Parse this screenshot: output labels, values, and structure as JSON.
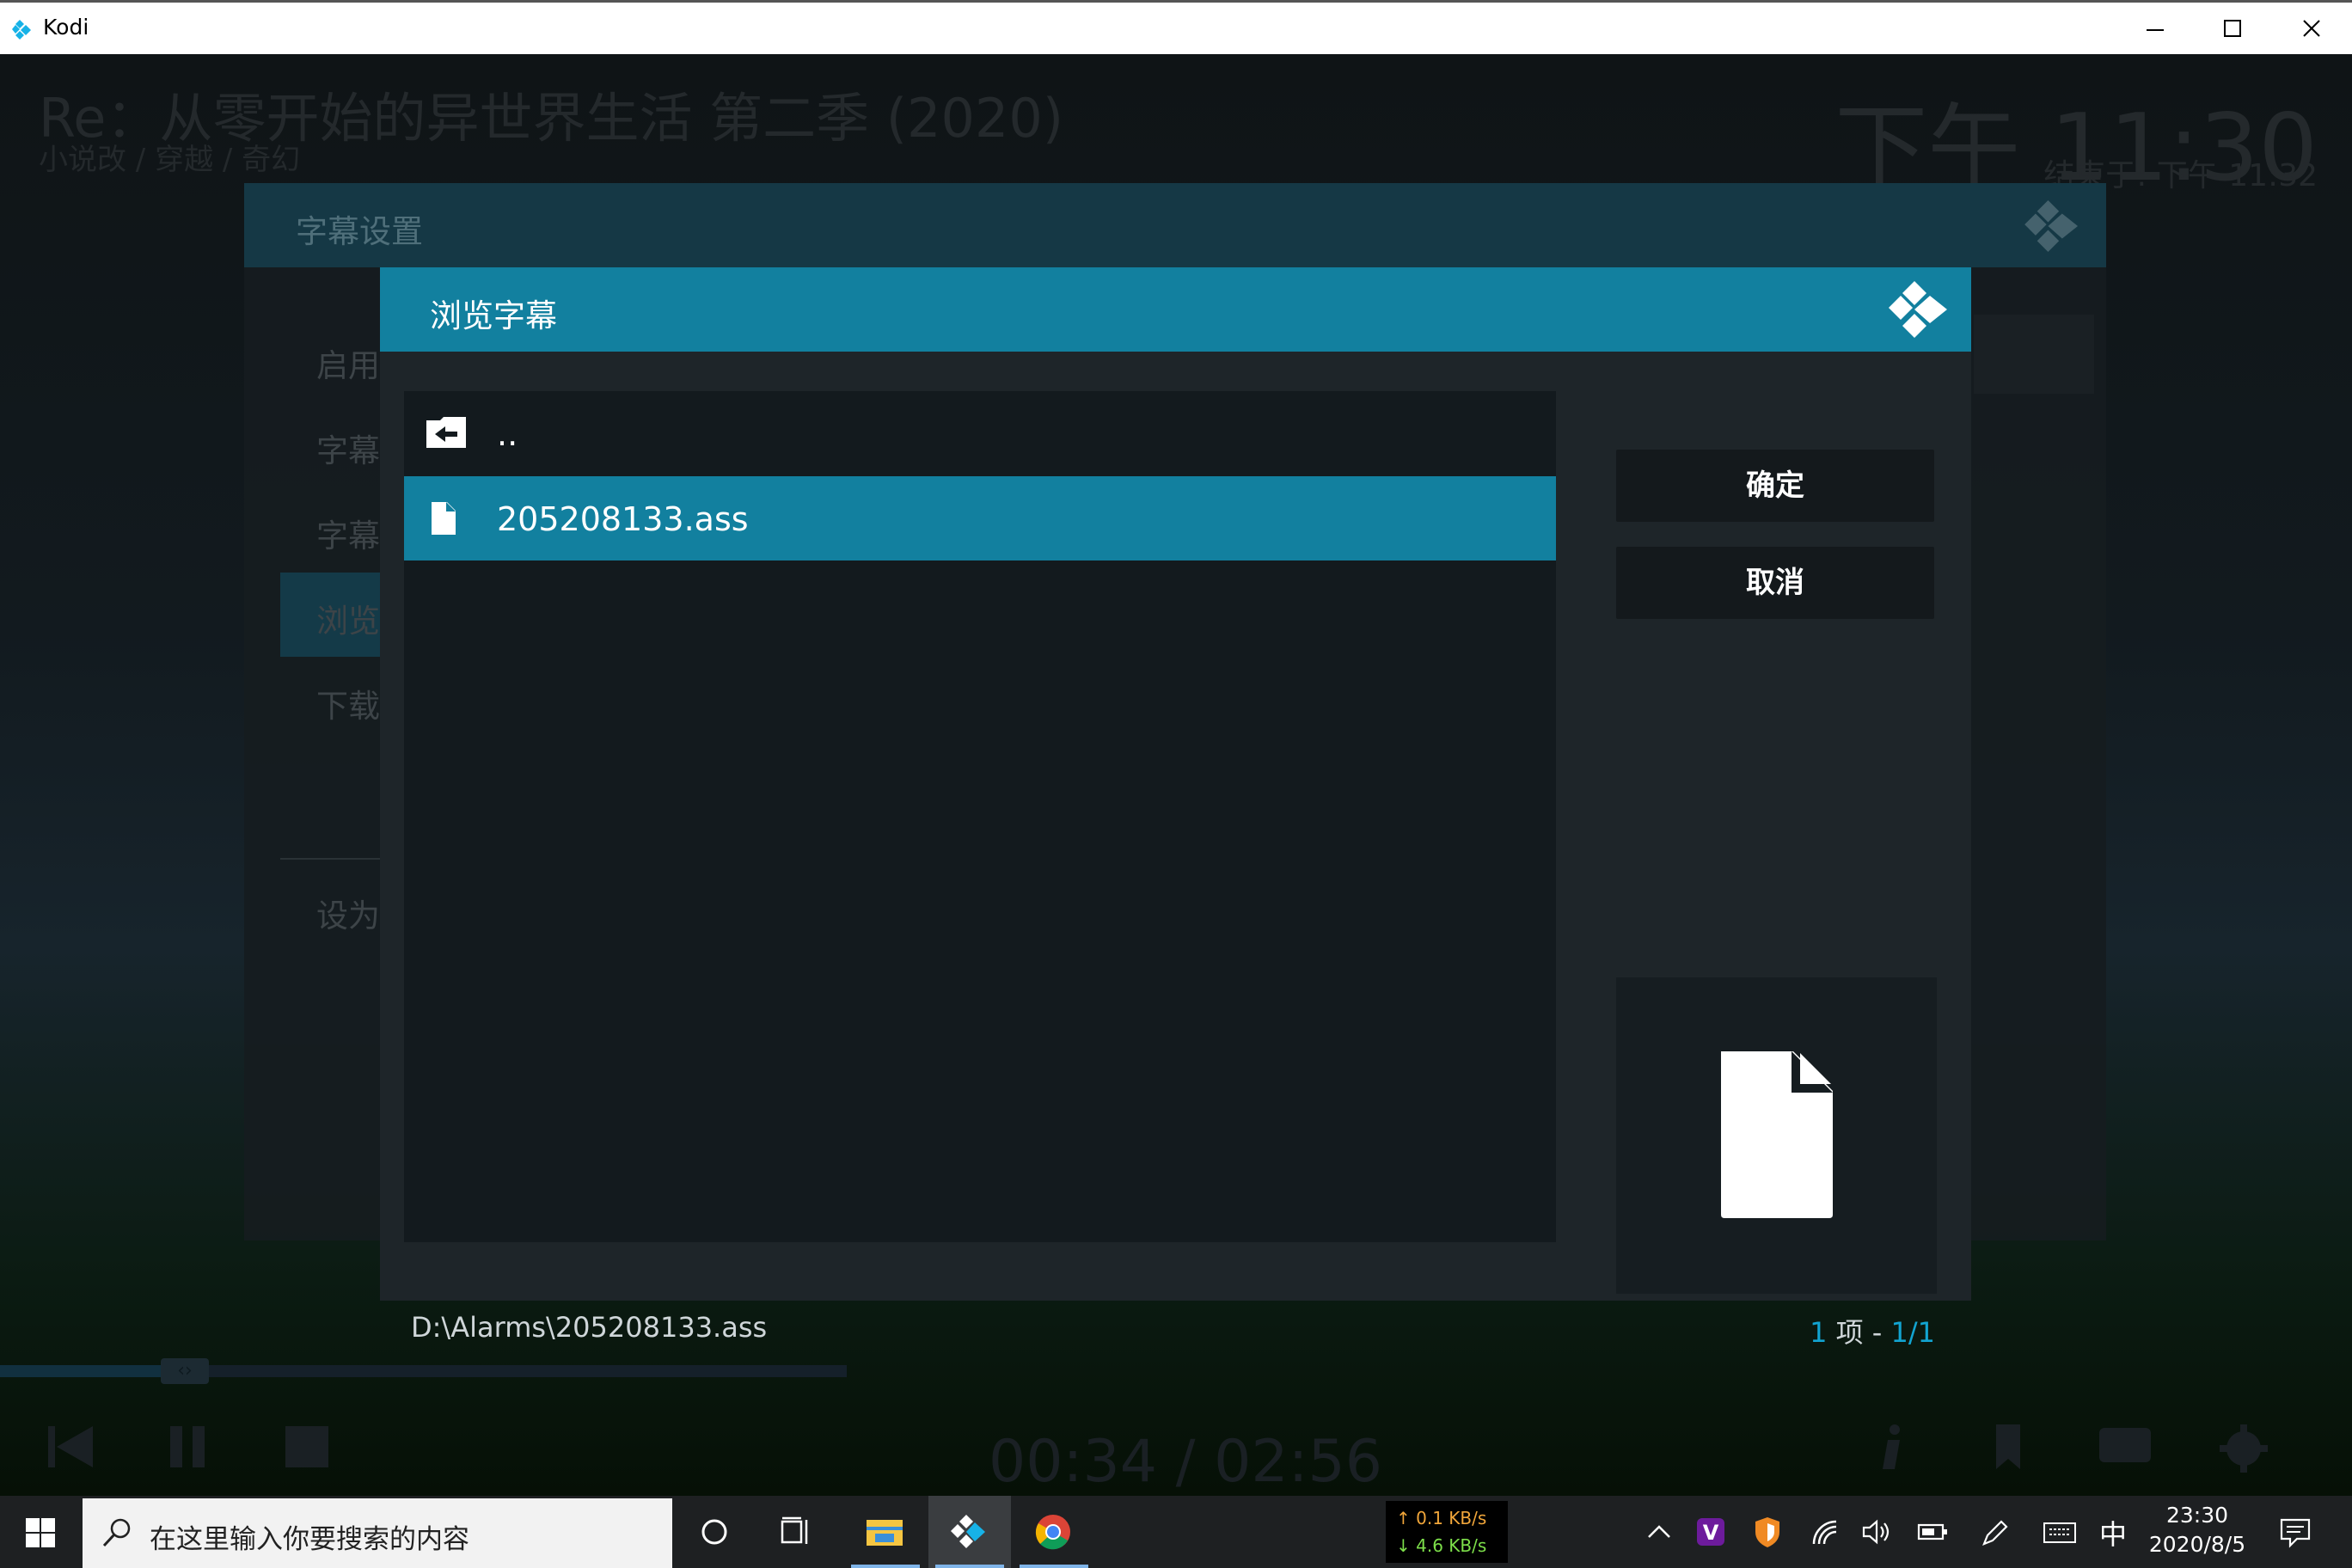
{
  "window": {
    "title": "Kodi",
    "controls": [
      "minimize",
      "maximize",
      "close"
    ]
  },
  "video": {
    "title": "Re：从零开始的异世界生活 第二季 (2020)",
    "genre": "小说改 / 穿越 / 奇幻",
    "clock": "下午 11:30",
    "ends_at": "结束于: 下午 11:32",
    "time_display": "00:34 / 02:56",
    "progress_fraction": 0.19
  },
  "settings_dialog": {
    "title": "字幕设置",
    "items": [
      "启用",
      "字幕",
      "字幕",
      "浏览",
      "下载",
      "设为"
    ],
    "focused_index": 3
  },
  "browse_dialog": {
    "title": "浏览字幕",
    "files": [
      {
        "label": "..",
        "icon": "folder-back-icon"
      },
      {
        "label": "205208133.ass",
        "icon": "file-icon",
        "selected": true
      }
    ],
    "ok_label": "确定",
    "cancel_label": "取消",
    "path": "D:\\Alarms\\205208133.ass",
    "count_num": "1",
    "count_unit": "项 -",
    "count_page": "1/1"
  },
  "taskbar": {
    "search_placeholder": "在这里输入你要搜索的内容",
    "net_up": "↑ 0.1 KB/s",
    "net_down": "↓ 4.6 KB/s",
    "ime": "中",
    "time": "23:30",
    "date": "2020/8/5"
  },
  "colors": {
    "accent": "#12809f",
    "accent_text": "#12a4d1",
    "dialog_bg": "#1e2529",
    "list_bg": "#131a1e"
  }
}
